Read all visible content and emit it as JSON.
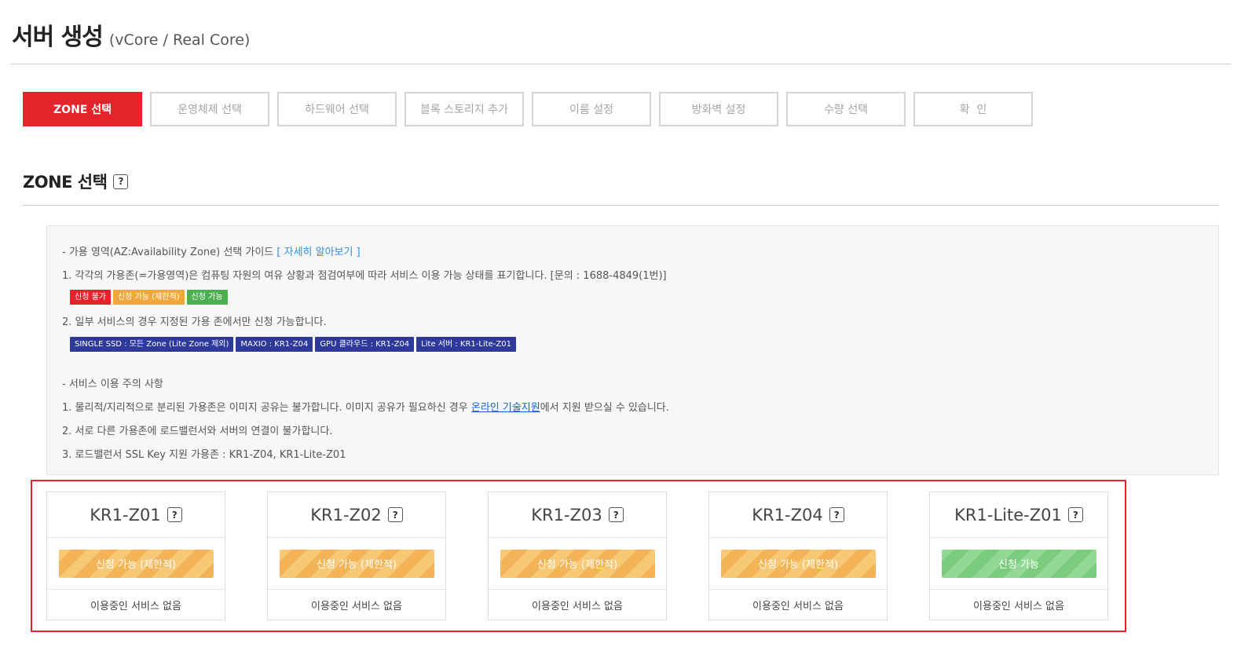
{
  "page": {
    "title": "서버 생성",
    "subtitle": "(vCore / Real Core)"
  },
  "steps": [
    {
      "label": "ZONE 선택",
      "active": true
    },
    {
      "label": "운영체제 선택",
      "active": false
    },
    {
      "label": "하드웨어 선택",
      "active": false
    },
    {
      "label": "블록 스토리지 추가",
      "active": false
    },
    {
      "label": "이름 설정",
      "active": false
    },
    {
      "label": "방화벽 설정",
      "active": false
    },
    {
      "label": "수량 선택",
      "active": false
    },
    {
      "label": "확  인",
      "active": false
    }
  ],
  "section": {
    "title": "ZONE 선택",
    "help": "?"
  },
  "guide": {
    "az_heading": "- 가용 영역(AZ:Availability Zone) 선택 가이드",
    "az_link": "[ 자세히 알아보기 ]",
    "line1": "1. 각각의 가용존(=가용영역)은 컴퓨팅 자원의 여유 상황과 점검여부에 따라 서비스 이용 가능 상태를 표기합니다. [문의 : 1688-4849(1번)]",
    "status_badges": [
      {
        "label": "신청 불가",
        "color": "#e3242b"
      },
      {
        "label": "신청 가능 (제한적)",
        "color": "#f0a83c"
      },
      {
        "label": "신청 가능",
        "color": "#4caf50"
      }
    ],
    "line2": "2. 일부 서비스의 경우 지정된 가용 존에서만 신청 가능합니다.",
    "service_badges": [
      {
        "label": "SINGLE SSD : 모든 Zone (Lite Zone 제외)",
        "color": "#2d3a9c"
      },
      {
        "label": "MAXIO : KR1-Z04",
        "color": "#2d3a9c"
      },
      {
        "label": "GPU 클라우드 : KR1-Z04",
        "color": "#2d3a9c"
      },
      {
        "label": "Lite 서버 : KR1-Lite-Z01",
        "color": "#2d3a9c"
      }
    ],
    "notice_heading": "- 서비스 이용 주의 사항",
    "notice1_pre": "1. 물리적/지리적으로 분리된 가용존은 이미지 공유는 불가합니다. 이미지 공유가 필요하신 경우 ",
    "notice1_link": "온라인 기술지원",
    "notice1_post": "에서 지원 받으실 수 있습니다.",
    "notice2": "2. 서로 다른 가용존에 로드밸런서와 서버의 연결이 불가합니다.",
    "notice3": "3. 로드밸런서 SSL Key 지원 가용존 : KR1-Z04, KR1-Lite-Z01"
  },
  "zones": [
    {
      "name": "KR1-Z01",
      "status": "신청 가능 (제한적)",
      "status_type": "limited",
      "usage": "이용중인 서비스 없음"
    },
    {
      "name": "KR1-Z02",
      "status": "신청 가능 (제한적)",
      "status_type": "limited",
      "usage": "이용중인 서비스 없음"
    },
    {
      "name": "KR1-Z03",
      "status": "신청 가능 (제한적)",
      "status_type": "limited",
      "usage": "이용중인 서비스 없음"
    },
    {
      "name": "KR1-Z04",
      "status": "신청 가능 (제한적)",
      "status_type": "limited",
      "usage": "이용중인 서비스 없음"
    },
    {
      "name": "KR1-Lite-Z01",
      "status": "신청 가능",
      "status_type": "available",
      "usage": "이용중인 서비스 없음"
    }
  ],
  "colors": {
    "accent": "#e3242b",
    "limited": "#f2b457",
    "available": "#7bcc7f",
    "service_badge": "#2d3a9c"
  }
}
